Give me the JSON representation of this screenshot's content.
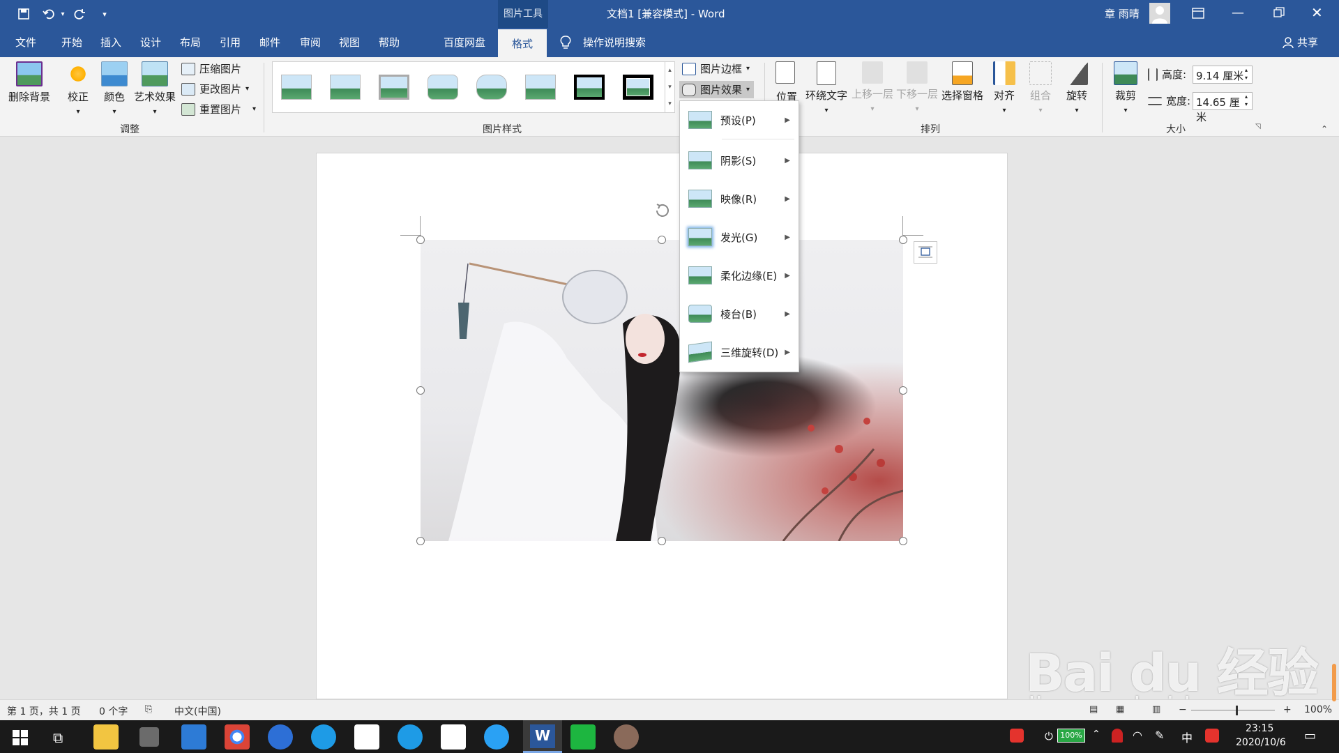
{
  "window": {
    "title": "文档1 [兼容模式]  -  Word",
    "context_tab_group": "图片工具",
    "user_name": "章 雨晴"
  },
  "tabs": [
    "文件",
    "开始",
    "插入",
    "设计",
    "布局",
    "引用",
    "邮件",
    "审阅",
    "视图",
    "帮助",
    "百度网盘",
    "格式"
  ],
  "active_tab": "格式",
  "tell_me": "操作说明搜索",
  "share": "共享",
  "ribbon": {
    "adjust": {
      "group_label": "调整",
      "remove_bg": "删除背景",
      "corrections": "校正",
      "color": "颜色",
      "artistic": "艺术效果",
      "compress": "压缩图片",
      "change": "更改图片",
      "reset": "重置图片"
    },
    "styles": {
      "group_label": "图片样式",
      "border": "图片边框",
      "effects": "图片效果"
    },
    "arrange": {
      "group_label": "排列",
      "position": "位置",
      "wrap": "环绕文字",
      "forward": "上移一层",
      "backward": "下移一层",
      "selection_pane": "选择窗格",
      "align": "对齐",
      "group": "组合",
      "rotate": "旋转"
    },
    "size": {
      "group_label": "大小",
      "crop": "裁剪",
      "height_label": "高度:",
      "height_value": "9.14 厘米",
      "width_label": "宽度:",
      "width_value": "14.65 厘米"
    }
  },
  "effects_menu": [
    {
      "label": "预设(P)"
    },
    {
      "label": "阴影(S)"
    },
    {
      "label": "映像(R)"
    },
    {
      "label": "发光(G)"
    },
    {
      "label": "柔化边缘(E)"
    },
    {
      "label": "棱台(B)"
    },
    {
      "label": "三维旋转(D)"
    }
  ],
  "status": {
    "page": "第 1 页，共 1 页",
    "words": "0 个字",
    "language": "中文(中国)",
    "zoom": "100%"
  },
  "taskbar": {
    "battery": "100%",
    "ime": "中",
    "time": "23:15",
    "date": "2020/10/6"
  },
  "watermark": {
    "brand": "Bai du 经验",
    "url": "jingyan.baidu.com"
  }
}
